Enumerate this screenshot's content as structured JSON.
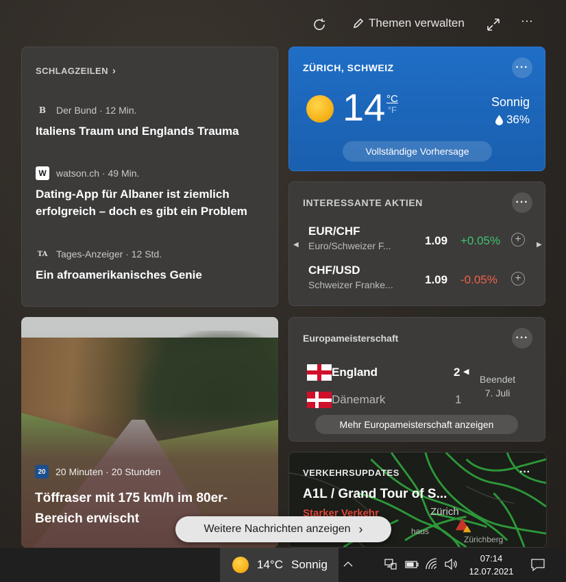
{
  "toolbar": {
    "refresh_icon": "refresh-icon",
    "manage_label": "Themen verwalten",
    "expand_icon": "expand-icon",
    "more_label": "···"
  },
  "headlines": {
    "header": "SCHLAGZEILEN",
    "items": [
      {
        "source": "Der Bund",
        "time": "12 Min.",
        "logo": "B",
        "title": "Italiens Traum und Englands Trauma"
      },
      {
        "source": "watson.ch",
        "time": "49 Min.",
        "logo": "W",
        "title": "Dating-App für Albaner ist ziemlich erfolgreich – doch es gibt ein Problem"
      },
      {
        "source": "Tages-Anzeiger",
        "time": "12 Std.",
        "logo": "TA",
        "title": "Ein afroamerikanisches Genie"
      }
    ]
  },
  "weather": {
    "location": "ZÜRICH, SCHWEIZ",
    "temperature": "14",
    "unit_c": "°C",
    "unit_f": "°F",
    "condition": "Sonnig",
    "humidity": "36%",
    "forecast_button": "Vollständige Vorhersage",
    "more": "···"
  },
  "stocks": {
    "header": "INTERESSANTE AKTIEN",
    "more": "···",
    "rows": [
      {
        "symbol": "EUR/CHF",
        "name": "Euro/Schweizer F...",
        "price": "1.09",
        "change": "+0.05%",
        "change_color": "#3ec46d"
      },
      {
        "symbol": "CHF/USD",
        "name": "Schweizer Franke...",
        "price": "1.09",
        "change": "-0.05%",
        "change_color": "#f1604a"
      }
    ]
  },
  "euro": {
    "header": "Europameisterschaft",
    "more": "···",
    "team1": {
      "name": "England",
      "score": "2"
    },
    "team2": {
      "name": "Dänemark",
      "score": "1"
    },
    "status_line1": "Beendet",
    "status_line2": "7. Juli",
    "button": "Mehr Europameisterschaft anzeigen"
  },
  "news_photo": {
    "source": "20 Minuten",
    "time": "20 Stunden",
    "logo": "20",
    "title": "Töffraser mit 175 km/h im 80er-Bereich erwischt"
  },
  "traffic": {
    "header": "VERKEHRSUPDATES",
    "more": "···",
    "title": "A1L / Grand Tour of S...",
    "subtitle": "Starker Verkehr",
    "map_label": "Zürich",
    "map_label2": "Zürichberg",
    "map_label3": "haus"
  },
  "more_news": {
    "label": "Weitere Nachrichten anzeigen"
  },
  "taskbar": {
    "weather_temp": "14°C",
    "weather_cond": "Sonnig",
    "time": "07:14",
    "date": "12.07.2021"
  }
}
